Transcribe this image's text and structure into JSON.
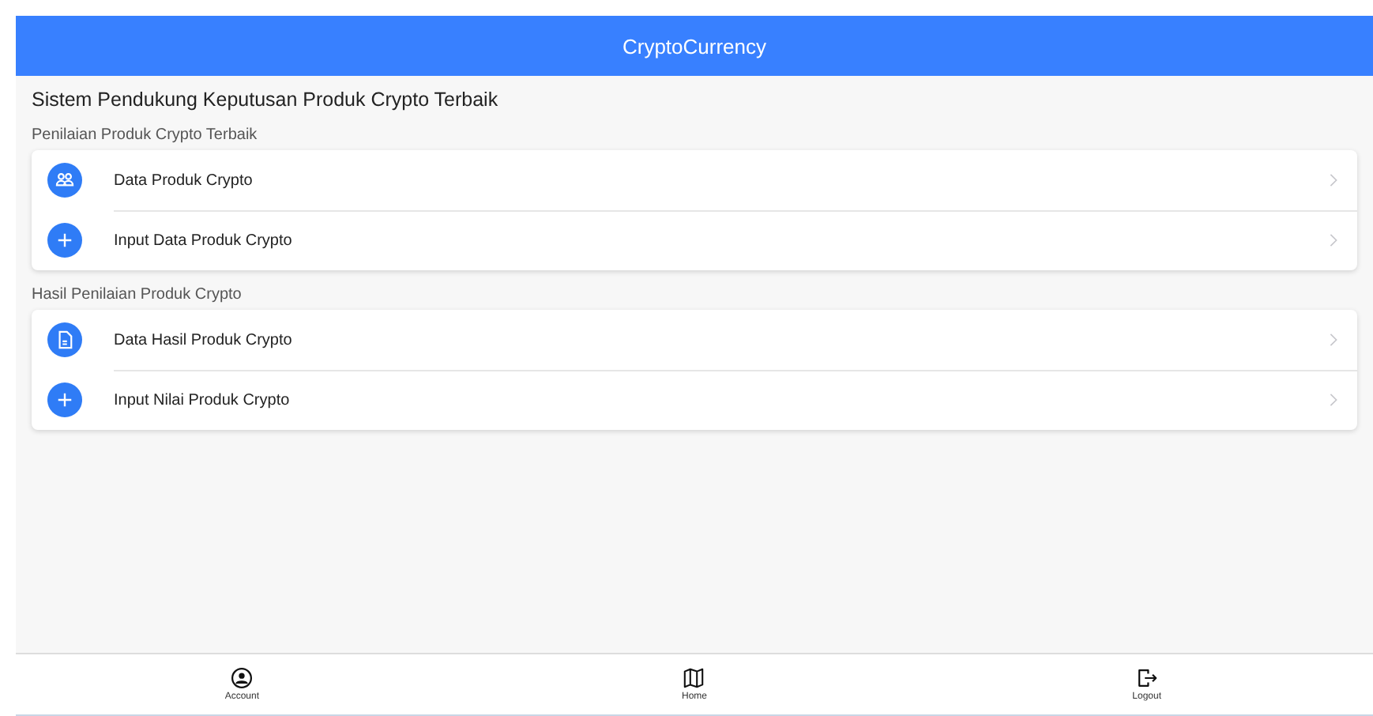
{
  "header": {
    "title": "CryptoCurrency"
  },
  "page_title": "Sistem Pendukung Keputusan Produk Crypto Terbaik",
  "sections": [
    {
      "heading": "Penilaian Produk Crypto Terbaik",
      "items": [
        {
          "label": "Data Produk Crypto",
          "kind": "people"
        },
        {
          "label": "Input Data Produk Crypto",
          "kind": "plus"
        }
      ]
    },
    {
      "heading": "Hasil Penilaian Produk Crypto",
      "items": [
        {
          "label": "Data Hasil Produk Crypto",
          "kind": "document"
        },
        {
          "label": "Input Nilai Produk Crypto",
          "kind": "plus"
        }
      ]
    }
  ],
  "bottom_nav": [
    {
      "label": "Account",
      "kind": "account"
    },
    {
      "label": "Home",
      "kind": "map"
    },
    {
      "label": "Logout",
      "kind": "logout"
    }
  ]
}
